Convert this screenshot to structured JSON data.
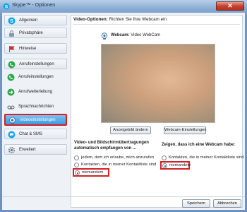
{
  "window": {
    "title": "Skype™ - Optionen",
    "close_glyph": "✕"
  },
  "sidebar": {
    "items": [
      {
        "label": "Allgemein",
        "icon": "skype-icon"
      },
      {
        "label": "Privatsphäre",
        "icon": "lock-icon"
      },
      {
        "label": "Hinweise",
        "icon": "flag-icon"
      },
      {
        "label": "Anrufeinstellungen",
        "icon": "phone-icon"
      },
      {
        "label": "Anrufeinstellungen",
        "icon": "phone-icon"
      },
      {
        "label": "Anrufweiterleitung",
        "icon": "forward-icon"
      },
      {
        "label": "Sprachnachrichten",
        "icon": "voicemail-icon"
      },
      {
        "label": "Videoeinstellungen",
        "icon": "webcam-icon",
        "selected": true
      },
      {
        "label": "Chat & SMS",
        "icon": "chat-icon"
      },
      {
        "label": "Erweitert",
        "icon": "gear-icon"
      }
    ]
  },
  "main": {
    "header_bold": "Video-Optionen:",
    "header_text": " Richten Sie Ihre Webcam ein",
    "webcam_label": "Webcam:",
    "webcam_value": " Video WebCam",
    "change_picture_button": "Anzeigebild ändern",
    "webcam_settings_button": "Webcam-Einstellungen",
    "receive": {
      "title_line1": "Video- und Bildschirmübertragungen",
      "title_line2": "automatisch empfangen von ...",
      "options": [
        {
          "label": "jedem, dem ich erlaube, mich anzurufen",
          "checked": false
        },
        {
          "label": "Kontakten, die in meiner Kontaktliste sind",
          "checked": false
        },
        {
          "label": "niemandem",
          "checked": true
        }
      ]
    },
    "show": {
      "title": "Zeigen, dass ich eine Webcam habe:",
      "options": [
        {
          "label": "Kontakten, die in meiner Kontaktliste sind",
          "checked": false
        },
        {
          "label": "niemandem",
          "checked": true
        }
      ]
    }
  },
  "footer": {
    "save_button": "Speichern",
    "cancel_button": "Abbrechen"
  },
  "colors": {
    "highlight": "#d61f26",
    "selected_bg": "#3a9ce0"
  }
}
